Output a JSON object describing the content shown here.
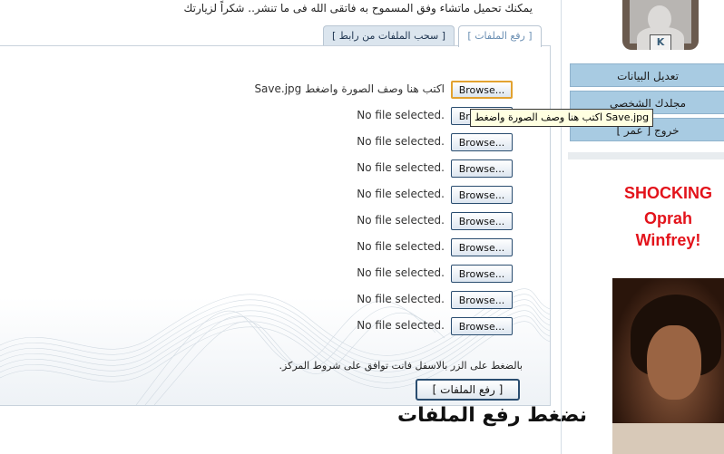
{
  "notice": "يمكنك تحميل ماتشاء وفق المسموح به فاتقى الله فى ما تنشر.. شكراً لزيارتك",
  "tabs": {
    "upload": "[ رفع الملفات ]",
    "from_link": "[ سحب الملفات من رابط ]"
  },
  "browse_label": "Browse...",
  "file_rows": [
    {
      "status": "اكتب هنا وصف الصورة واضغط Save.jpg"
    },
    {
      "status": "No file selected."
    },
    {
      "status": "No file selected."
    },
    {
      "status": "No file selected."
    },
    {
      "status": "No file selected."
    },
    {
      "status": "No file selected."
    },
    {
      "status": "No file selected."
    },
    {
      "status": "No file selected."
    },
    {
      "status": "No file selected."
    },
    {
      "status": "No file selected."
    }
  ],
  "tooltip": "اكتب هنا وصف الصورة واضغط Save.jpg",
  "terms": "بالضغط على الزر بالاسفل فانت توافق على شروط المركز.",
  "upload_button": "[ رفع الملفات ]",
  "caption": "نضغط رفع الملفات",
  "sidebar": {
    "avatar_logo": "K",
    "menu": [
      "تعديل البيانات",
      "مجلدك الشخصي",
      "خروج [ عمر ]"
    ]
  },
  "ad": {
    "lines": [
      "SHOCKING",
      "Oprah",
      "Winfrey!"
    ]
  },
  "colors": {
    "menu_bg": "#a8cbe2",
    "ad_text": "#e3131b",
    "focus_border": "#e2a230"
  }
}
